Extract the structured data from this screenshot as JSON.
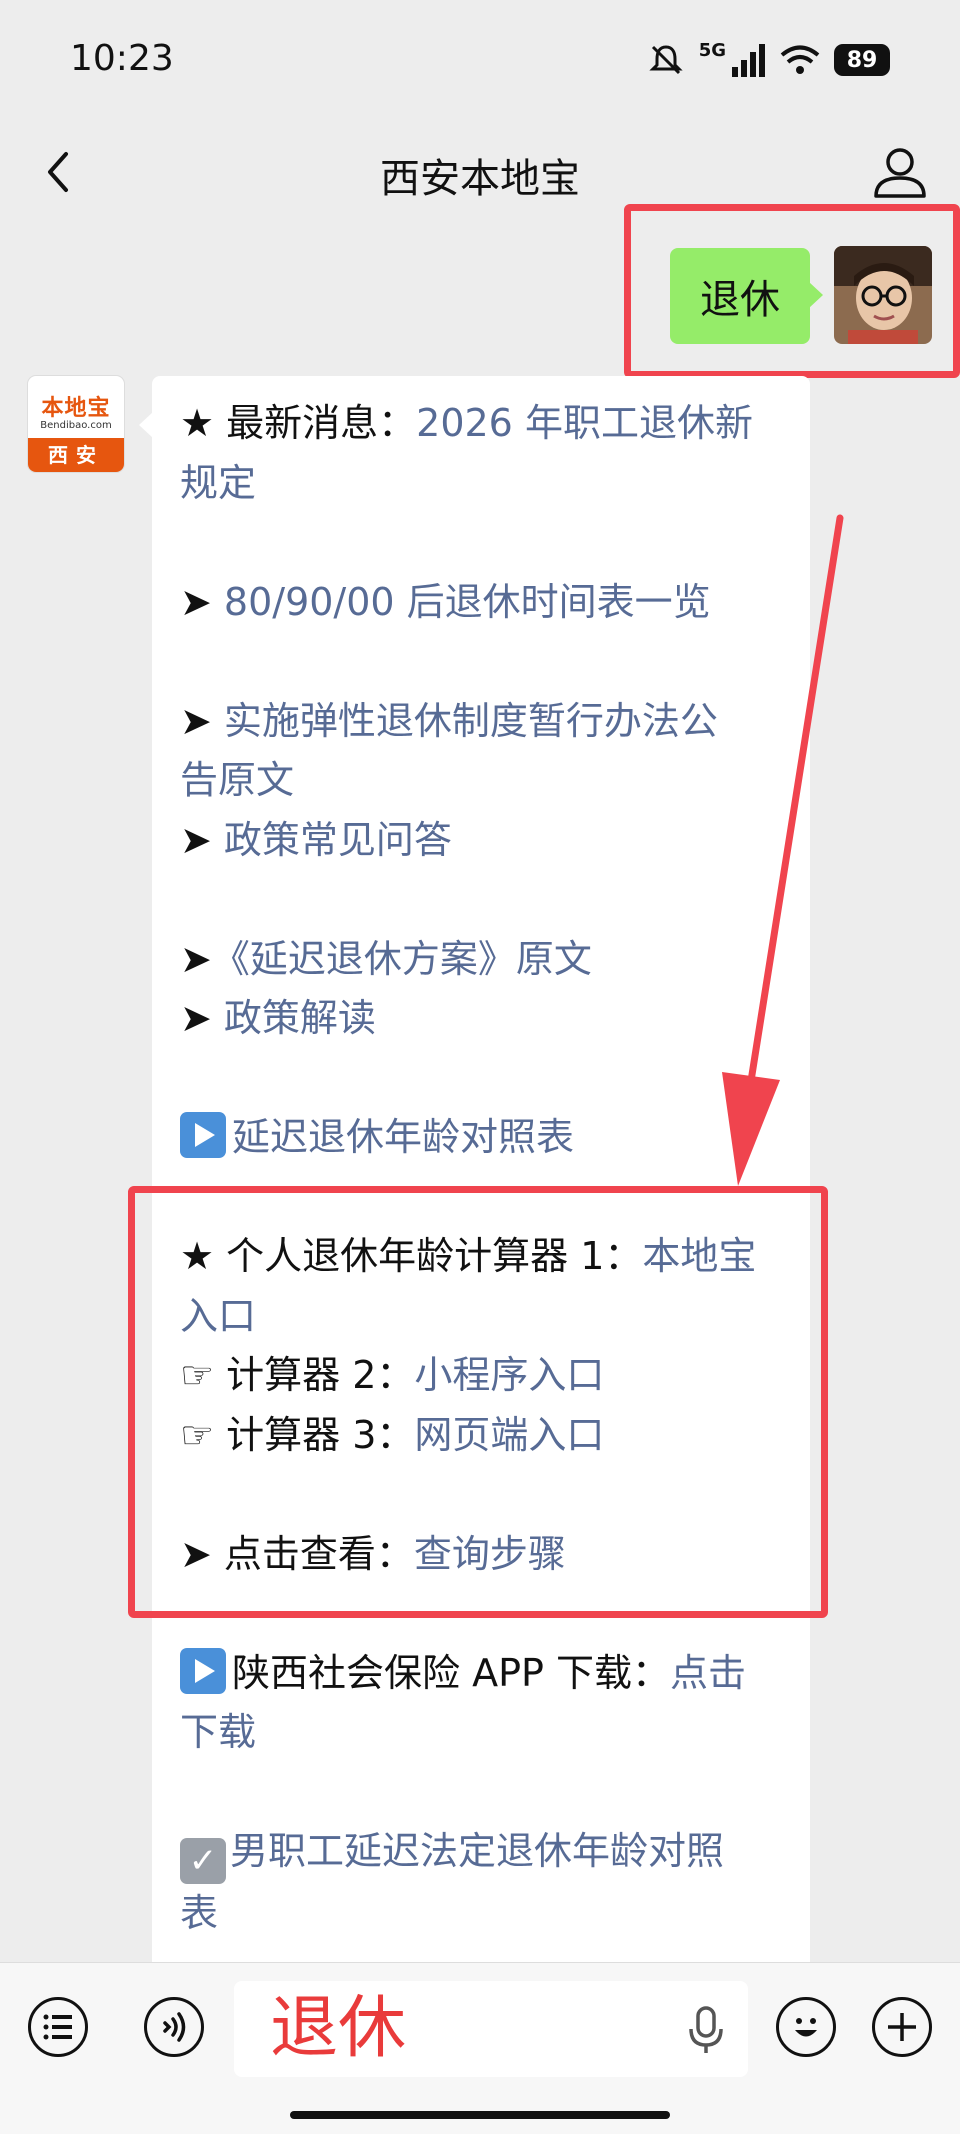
{
  "status_bar": {
    "time": "10:23",
    "network": "5G",
    "battery": "89"
  },
  "nav": {
    "title": "西安本地宝"
  },
  "user_message": {
    "text": "退休"
  },
  "bot": {
    "logo_top": "本地宝",
    "logo_sub": "Bendibao.com",
    "logo_bottom": "西安",
    "lines": {
      "l1_prefix": "★ 最新消息：",
      "l1_link": "2026 年职工退休新",
      "l2_link": "规定",
      "l3_arrow": "➤ ",
      "l3_link": "80/90/00 后退休时间表一览",
      "l4_arrow": "➤ ",
      "l4_link": "实施弹性退休制度暂行办法公",
      "l5_link": "告原文",
      "l6_arrow": "➤ ",
      "l6_link": "政策常见问答",
      "l7_arrow": "➤",
      "l7_link": "《延迟退休方案》原文",
      "l8_arrow": "➤ ",
      "l8_link": "政策解读",
      "l9_link": "延迟退休年龄对照表",
      "l10_prefix": "★ 个人退休年龄计算器 1：",
      "l10_link": "本地宝",
      "l11_link": "入口",
      "l12_prefix": "☞ 计算器 2：",
      "l12_link": "小程序入口",
      "l13_prefix": "☞ 计算器 3：",
      "l13_link": "网页端入口",
      "l14_prefix": "➤ 点击查看：",
      "l14_link": "查询步骤",
      "l15_prefix": "陕西社会保险 APP 下载：",
      "l15_link": "点击",
      "l16_link": "下载",
      "l17_link": "男职工延迟法定退休年龄对照",
      "l18_link": "表"
    }
  },
  "input": {
    "value": "退休"
  },
  "icons": {
    "back": "chevron-left-icon",
    "profile": "person-icon",
    "menu": "list-icon",
    "voice": "voice-icon",
    "mic": "mic-icon",
    "emoji": "emoji-icon",
    "add": "plus-icon"
  },
  "colors": {
    "link": "#576b95",
    "bubble_user": "#95ec69",
    "highlight": "#f0444e",
    "input_text": "#e93b3b"
  }
}
